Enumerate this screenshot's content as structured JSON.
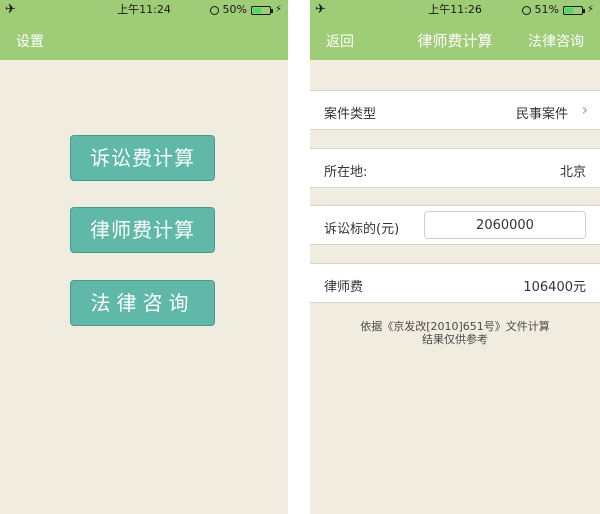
{
  "left_screen": {
    "status": {
      "airplane": "✈",
      "time": "上午11:24",
      "battery_text": "50%",
      "battery_level": 0.5,
      "charging": "⚡"
    },
    "nav": {
      "left_label": "设置"
    },
    "buttons": {
      "litigation_fee": "诉讼费计算",
      "lawyer_fee": "律师费计算",
      "legal_consult": "法律咨询"
    }
  },
  "right_screen": {
    "status": {
      "airplane": "✈",
      "time": "上午11:26",
      "battery_text": "51%",
      "battery_level": 0.51,
      "charging": "⚡"
    },
    "nav": {
      "back_label": "返回",
      "title": "律师费计算",
      "right_label": "法律咨询"
    },
    "rows": {
      "case_type": {
        "label": "案件类型",
        "value": "民事案件",
        "chevron": "›"
      },
      "location": {
        "label": "所在地:",
        "value": "北京"
      },
      "amount": {
        "label": "诉讼标的(元)",
        "value": "2060000"
      },
      "fee": {
        "label": "律师费",
        "value": "106400元"
      }
    },
    "note": {
      "line1": "依据《京发改[2010]651号》文件计算",
      "line2": "结果仅供参考"
    }
  },
  "colors": {
    "accent": "#9fcc76",
    "button": "#5fb8a8",
    "background": "#f0ece0"
  },
  "icons": [
    "airplane-icon",
    "alarm-icon",
    "battery-icon",
    "charging-icon",
    "chevron-right-icon"
  ]
}
